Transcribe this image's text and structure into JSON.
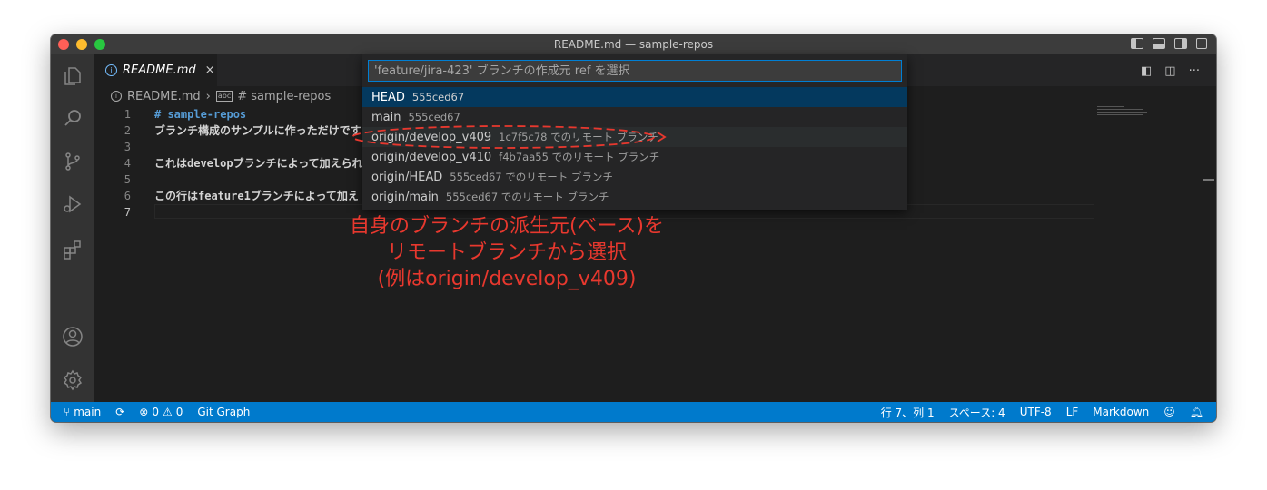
{
  "window": {
    "title": "README.md — sample-repos"
  },
  "tab": {
    "label": "README.md",
    "close": "×"
  },
  "breadcrumb": {
    "file": "README.md",
    "symbol": "# sample-repos"
  },
  "editor": {
    "lines": [
      {
        "num": "1",
        "text": "# sample-repos"
      },
      {
        "num": "2",
        "text": "ブランチ構成のサンプルに作っただけです"
      },
      {
        "num": "3",
        "text": ""
      },
      {
        "num": "4",
        "text": "これはdevelopブランチによって加えられ"
      },
      {
        "num": "5",
        "text": ""
      },
      {
        "num": "6",
        "text": "この行はfeature1ブランチによって加え"
      },
      {
        "num": "7",
        "text": ""
      }
    ]
  },
  "quickpick": {
    "placeholder": "'feature/jira-423' ブランチの作成元 ref を選択",
    "items": [
      {
        "label": "HEAD",
        "description": "555ced67"
      },
      {
        "label": "main",
        "description": "555ced67"
      },
      {
        "label": "origin/develop_v409",
        "description": "1c7f5c78 でのリモート ブランチ"
      },
      {
        "label": "origin/develop_v410",
        "description": "f4b7aa55 でのリモート ブランチ"
      },
      {
        "label": "origin/HEAD",
        "description": "555ced67 でのリモート ブランチ"
      },
      {
        "label": "origin/main",
        "description": "555ced67 でのリモート ブランチ"
      }
    ]
  },
  "statusbar": {
    "branch": "main",
    "errors": "0",
    "warnings": "0",
    "git_graph": "Git Graph",
    "position": "行 7、列 1",
    "spaces": "スペース: 4",
    "encoding": "UTF-8",
    "eol": "LF",
    "language": "Markdown"
  },
  "annotation": {
    "line1": "自身のブランチの派生元(ベース)を",
    "line2": "リモートブランチから選択",
    "line3": "(例はorigin/develop_v409)"
  },
  "colors": {
    "accent": "#007acc",
    "annotation": "#e8382e",
    "selection": "#04395e"
  }
}
